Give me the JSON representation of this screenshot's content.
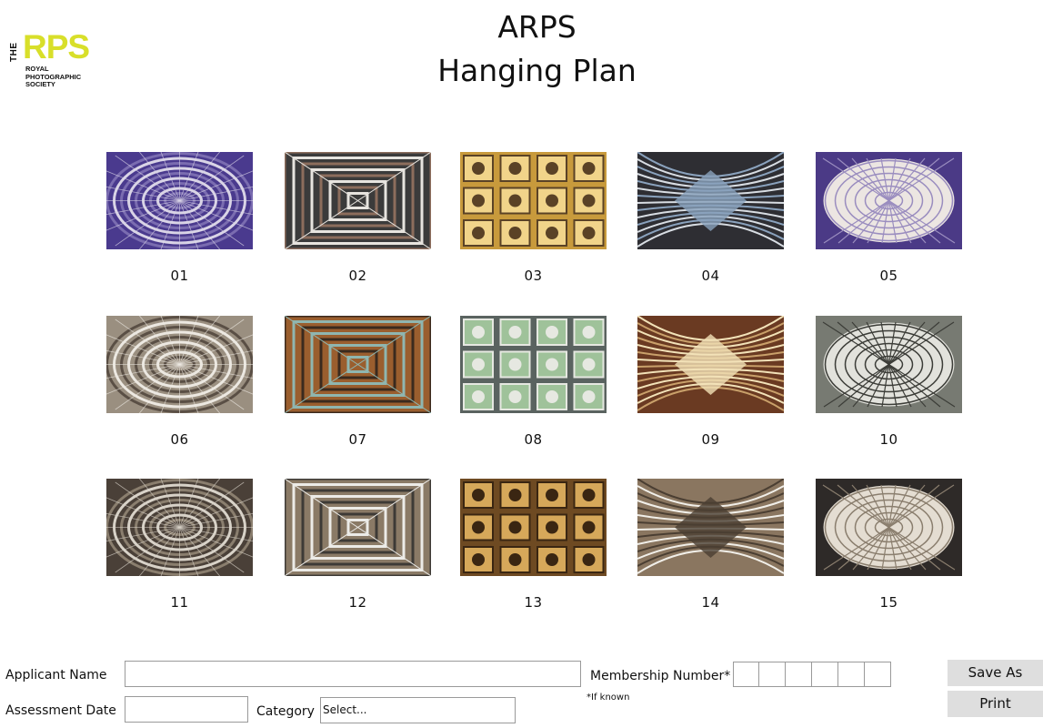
{
  "logo": {
    "the": "THE",
    "rps": "RPS",
    "line1": "ROYAL",
    "line2": "PHOTOGRAPHIC",
    "line3": "SOCIETY"
  },
  "header": {
    "title_line1": "ARPS",
    "title_line2": "Hanging Plan"
  },
  "images": [
    {
      "number": "01",
      "palette": [
        "#4a3a8e",
        "#d9d4e6",
        "#7a6cb0"
      ]
    },
    {
      "number": "02",
      "palette": [
        "#3b3b3b",
        "#e7e4df",
        "#8c6d5c"
      ]
    },
    {
      "number": "03",
      "palette": [
        "#c89a3c",
        "#f1d48a",
        "#5a4226"
      ]
    },
    {
      "number": "04",
      "palette": [
        "#2e2e33",
        "#d8dde3",
        "#8aa2bd"
      ]
    },
    {
      "number": "05",
      "palette": [
        "#4b3a86",
        "#ece6e2",
        "#9a8dbf"
      ]
    },
    {
      "number": "06",
      "palette": [
        "#9a8f80",
        "#ece8e1",
        "#5a4f45"
      ]
    },
    {
      "number": "07",
      "palette": [
        "#9a5e2e",
        "#8fb6b0",
        "#3a2a1e"
      ]
    },
    {
      "number": "08",
      "palette": [
        "#5a6360",
        "#9fc29a",
        "#e6e8e1"
      ]
    },
    {
      "number": "09",
      "palette": [
        "#6a3a22",
        "#c9a06a",
        "#f2e2b8"
      ]
    },
    {
      "number": "10",
      "palette": [
        "#777a72",
        "#e2e2dc",
        "#3c3d38"
      ]
    },
    {
      "number": "11",
      "palette": [
        "#4a4038",
        "#d8d2c8",
        "#8a7e6e"
      ]
    },
    {
      "number": "12",
      "palette": [
        "#8a7a66",
        "#ecebe7",
        "#3d3a36"
      ]
    },
    {
      "number": "13",
      "palette": [
        "#6e4a22",
        "#d6a85a",
        "#3a2612"
      ]
    },
    {
      "number": "14",
      "palette": [
        "#8a7660",
        "#f1efe9",
        "#4a3e32"
      ]
    },
    {
      "number": "15",
      "palette": [
        "#2e2a28",
        "#e4ddd2",
        "#8a7e6e"
      ]
    }
  ],
  "form": {
    "applicant_name_label": "Applicant Name",
    "applicant_name_value": "",
    "assessment_date_label": "Assessment Date",
    "assessment_date_value": "",
    "category_label": "Category",
    "category_selected": "Select...",
    "membership_label": "Membership Number*",
    "membership_note": "*If known",
    "membership_cells": 6
  },
  "buttons": {
    "save_as": "Save As",
    "print": "Print"
  },
  "colors": {
    "accent": "#d8df2a",
    "button_bg": "#dedede",
    "field_border": "#9a9a9a"
  }
}
